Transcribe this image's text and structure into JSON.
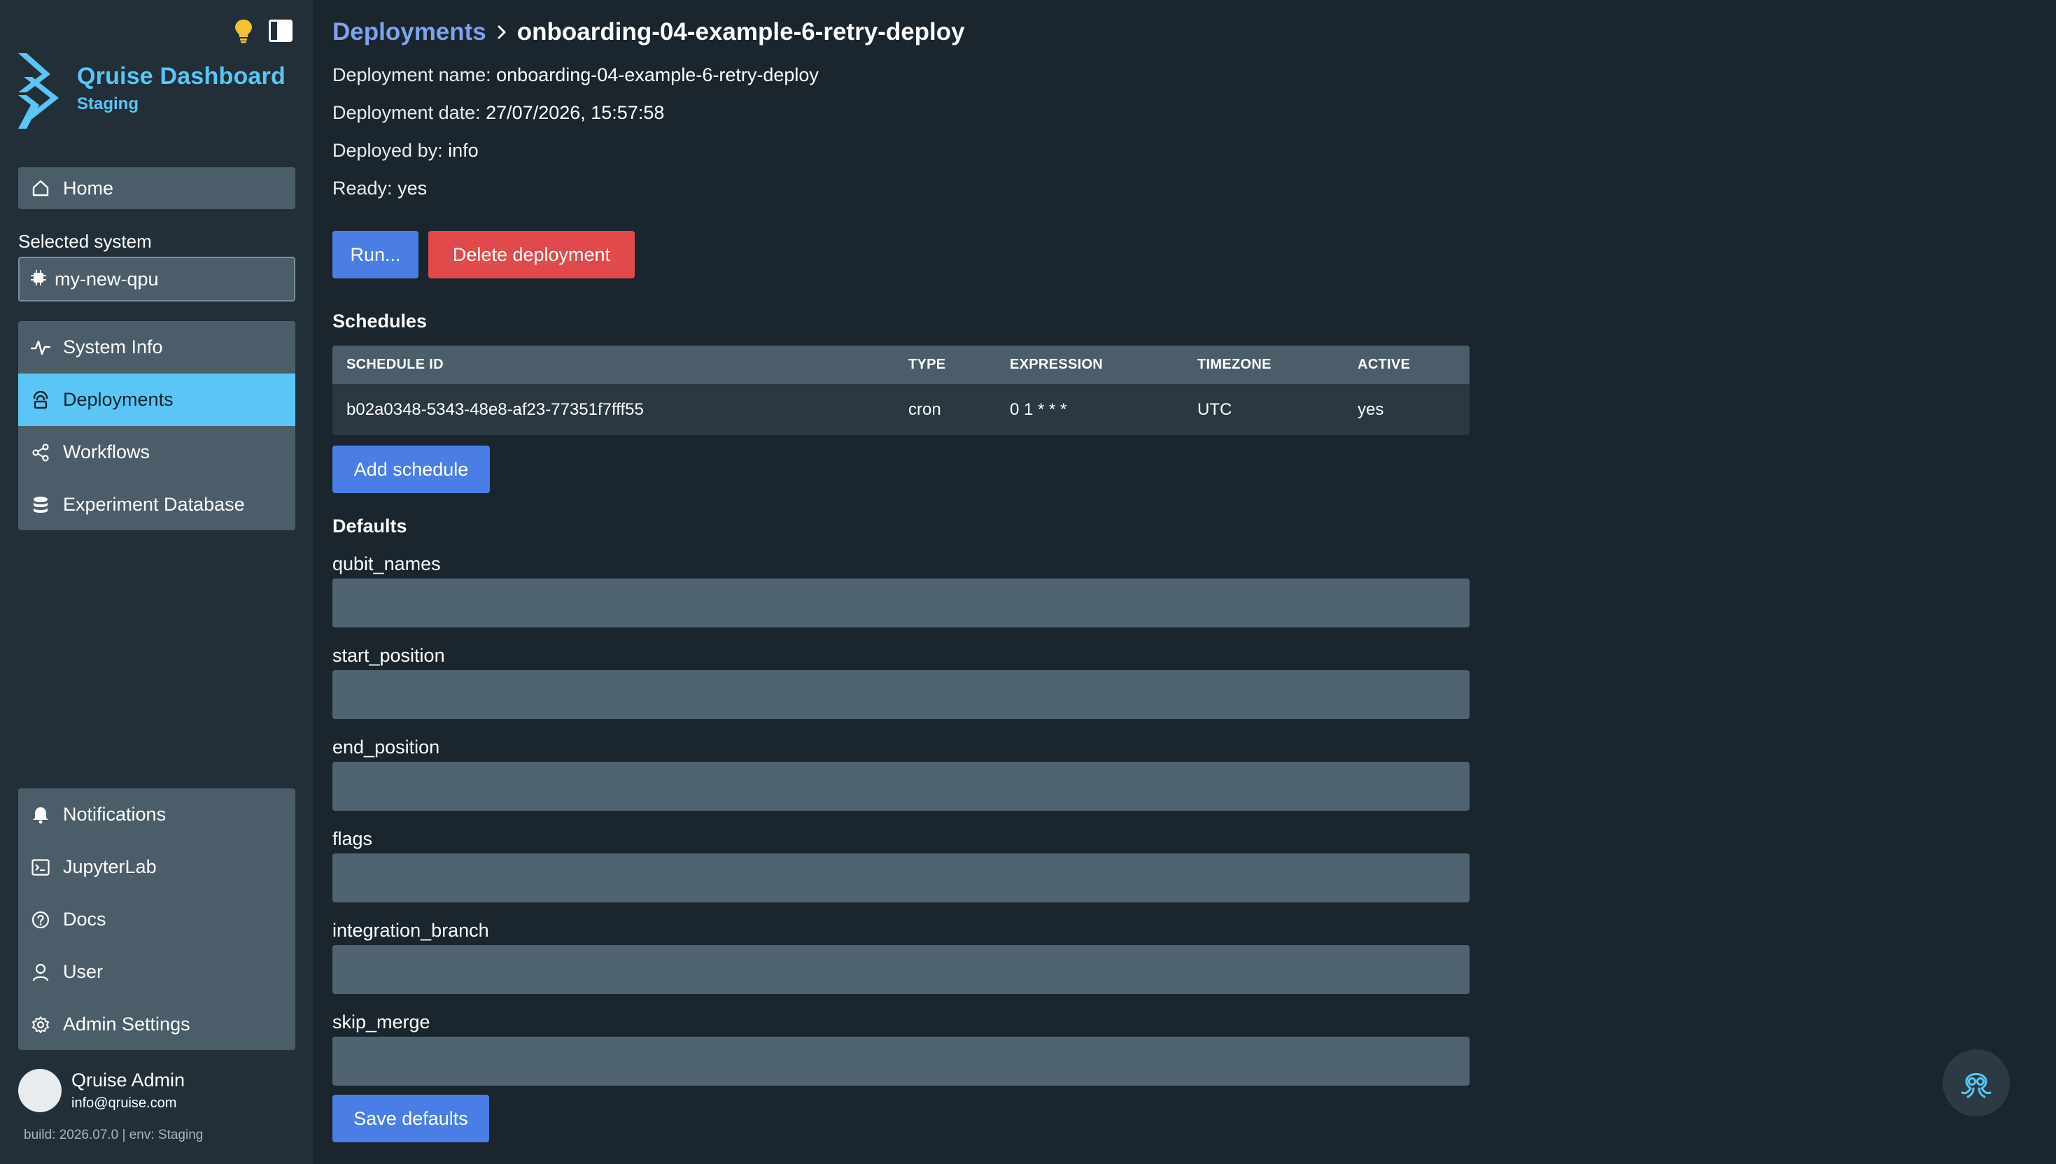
{
  "sidebar": {
    "brand": {
      "title": "Qruise Dashboard",
      "subtitle": "Staging"
    },
    "home_label": "Home",
    "selected_system_label": "Selected system",
    "selected_system_value": "my-new-qpu",
    "main_items": [
      {
        "label": "System Info",
        "icon": "activity-icon"
      },
      {
        "label": "Deployments",
        "icon": "deployment-icon",
        "active": true
      },
      {
        "label": "Workflows",
        "icon": "share-nodes-icon"
      },
      {
        "label": "Experiment Database",
        "icon": "database-icon"
      }
    ],
    "bottom_items": [
      {
        "label": "Notifications",
        "icon": "bell-icon"
      },
      {
        "label": "JupyterLab",
        "icon": "terminal-icon"
      },
      {
        "label": "Docs",
        "icon": "help-circle-icon"
      },
      {
        "label": "User",
        "icon": "user-icon"
      },
      {
        "label": "Admin Settings",
        "icon": "gear-icon"
      }
    ],
    "user": {
      "name": "Qruise Admin",
      "email": "info@qruise.com"
    },
    "build_info": "build: 2026.07.0 | env: Staging"
  },
  "breadcrumb": {
    "parent": "Deployments",
    "current": "onboarding-04-example-6-retry-deploy"
  },
  "deployment": {
    "name_label": "Deployment name:",
    "name_value": "onboarding-04-example-6-retry-deploy",
    "date_label": "Deployment date:",
    "date_value": "27/07/2026, 15:57:58",
    "by_label": "Deployed by:",
    "by_value": "info",
    "ready_label": "Ready:",
    "ready_value": "yes"
  },
  "actions": {
    "run_label": "Run...",
    "delete_label": "Delete deployment"
  },
  "schedules": {
    "title": "Schedules",
    "columns": [
      "SCHEDULE ID",
      "TYPE",
      "EXPRESSION",
      "TIMEZONE",
      "ACTIVE"
    ],
    "rows": [
      [
        "b02a0348-5343-48e8-af23-77351f7fff55",
        "cron",
        "0 1 * * *",
        "UTC",
        "yes"
      ]
    ],
    "add_label": "Add schedule"
  },
  "defaults": {
    "title": "Defaults",
    "fields": [
      {
        "label": "qubit_names",
        "value": ""
      },
      {
        "label": "start_position",
        "value": ""
      },
      {
        "label": "end_position",
        "value": ""
      },
      {
        "label": "flags",
        "value": ""
      },
      {
        "label": "integration_branch",
        "value": ""
      },
      {
        "label": "skip_merge",
        "value": ""
      }
    ],
    "save_label": "Save defaults"
  },
  "colors": {
    "accent": "#5bc6f5",
    "primary_button": "#4a7ee5",
    "danger_button": "#e14a4a",
    "background": "#1a252d",
    "sidebar": "#222f38"
  }
}
